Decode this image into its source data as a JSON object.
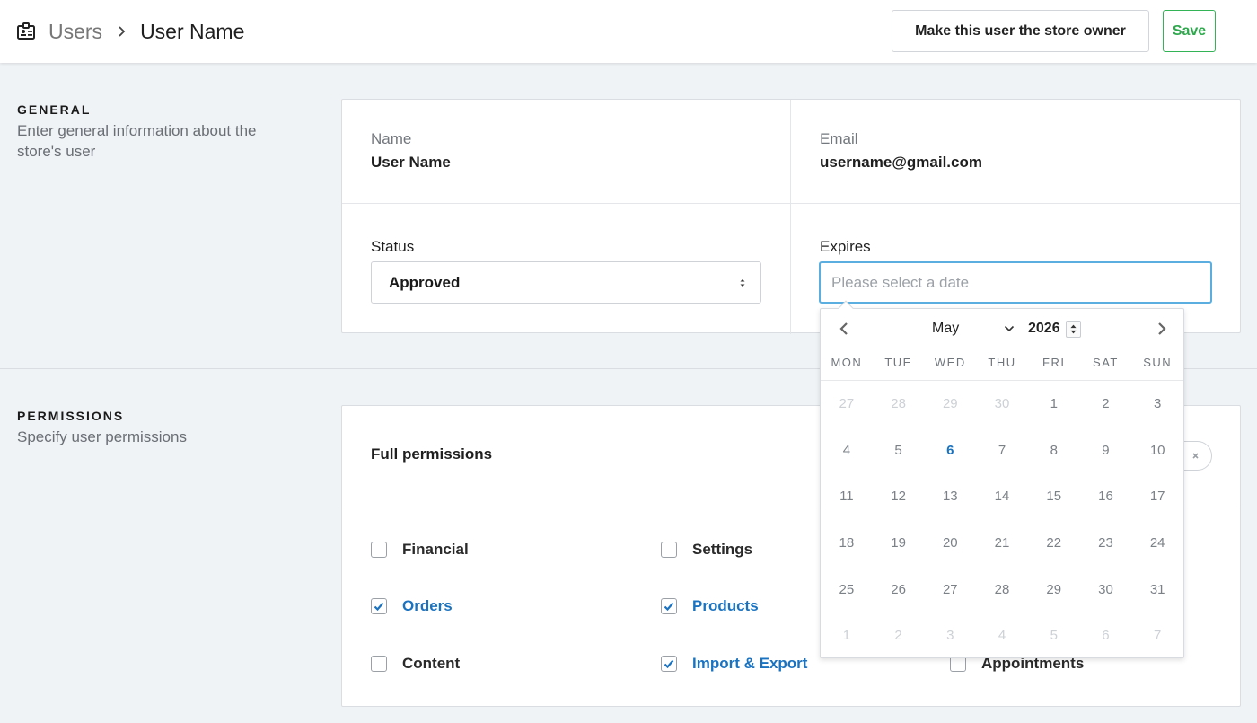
{
  "header": {
    "breadcrumb_parent": "Users",
    "breadcrumb_current": "User Name",
    "owner_button": "Make this user the store owner",
    "save_button": "Save"
  },
  "general": {
    "title": "GENERAL",
    "description": "Enter general information about the store's user",
    "name_label": "Name",
    "name_value": "User Name",
    "email_label": "Email",
    "email_value": "username@gmail.com",
    "status_label": "Status",
    "status_value": "Approved",
    "expires_label": "Expires",
    "expires_placeholder": "Please select a date"
  },
  "permissions": {
    "title": "PERMISSIONS",
    "description": "Specify user permissions",
    "full_label": "Full permissions",
    "items": [
      {
        "label": "Financial",
        "checked": false
      },
      {
        "label": "Settings",
        "checked": false
      },
      {
        "label": "Orders",
        "checked": true
      },
      {
        "label": "Products",
        "checked": true
      },
      {
        "label": "Content",
        "checked": false
      },
      {
        "label": "Import & Export",
        "checked": true
      },
      {
        "label": "Appointments",
        "checked": false
      }
    ]
  },
  "datepicker": {
    "month": "May",
    "year": "2026",
    "weekdays": [
      "MON",
      "TUE",
      "WED",
      "THU",
      "FRI",
      "SAT",
      "SUN"
    ],
    "weeks": [
      [
        "27",
        "28",
        "29",
        "30",
        "1",
        "2",
        "3"
      ],
      [
        "4",
        "5",
        "6",
        "7",
        "8",
        "9",
        "10"
      ],
      [
        "11",
        "12",
        "13",
        "14",
        "15",
        "16",
        "17"
      ],
      [
        "18",
        "19",
        "20",
        "21",
        "22",
        "23",
        "24"
      ],
      [
        "25",
        "26",
        "27",
        "28",
        "29",
        "30",
        "31"
      ],
      [
        "1",
        "2",
        "3",
        "4",
        "5",
        "6",
        "7"
      ]
    ],
    "today": "6"
  },
  "colors": {
    "accent_blue": "#1a73c1",
    "save_green": "#2ea84c",
    "focus_blue": "#5aaee0"
  }
}
